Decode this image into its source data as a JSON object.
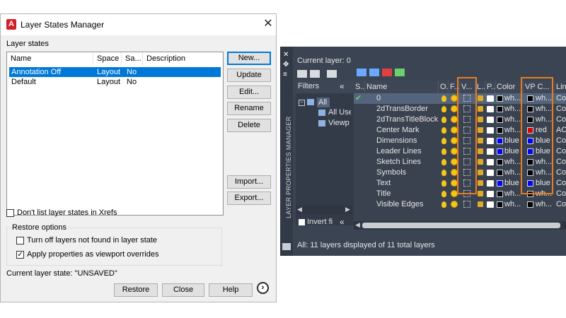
{
  "dialog": {
    "title": "Layer States Manager",
    "close_symbol": "✕",
    "layer_states_label": "Layer states",
    "columns": [
      "Name",
      "Space",
      "Sa...",
      "Description"
    ],
    "rows": [
      {
        "name": "Annotation Off",
        "space": "Layout",
        "saved": "No",
        "description": ""
      },
      {
        "name": "Default",
        "space": "Layout",
        "saved": "No",
        "description": ""
      }
    ],
    "buttons": {
      "new": "New...",
      "update": "Update",
      "edit": "Edit...",
      "rename": "Rename",
      "delete": "Delete",
      "import": "Import...",
      "export": "Export..."
    },
    "dont_list_xrefs": "Don't list layer states in Xrefs",
    "restore_options_label": "Restore options",
    "turn_off_layers": "Turn off layers not found in layer state",
    "apply_overrides": "Apply properties as viewport overrides",
    "current_state": "Current layer state: \"UNSAVED\"",
    "bottom": {
      "restore": "Restore",
      "close": "Close",
      "help": "Help",
      "more_symbol": "›"
    },
    "checkbox_states": {
      "dont_list_xrefs": false,
      "turn_off_layers": false,
      "apply_overrides": true
    }
  },
  "palette": {
    "current_layer": "Current layer: 0",
    "side_title": "LAYER PROPERTIES MANAGER",
    "filters_label": "Filters",
    "collapse_symbol": "«",
    "tree": [
      {
        "label": "All"
      },
      {
        "label": "All Use"
      },
      {
        "label": "Viewp"
      }
    ],
    "invert_filter": "Invert fi",
    "columns": [
      "S...",
      "Name",
      "O...",
      "F...",
      "V...",
      "L...",
      "P...",
      "Color",
      "VP C...",
      "Line"
    ],
    "layers": [
      {
        "status": "✔",
        "name": "0",
        "color_name": "wh...",
        "color": "#000000",
        "vp_color_name": "wh...",
        "vp_color": "#000000",
        "line": "Con"
      },
      {
        "status": "",
        "name": "2dTransBorder",
        "color_name": "wh...",
        "color": "#000000",
        "vp_color_name": "wh...",
        "vp_color": "#000000",
        "line": "Con"
      },
      {
        "status": "",
        "name": "2dTransTitleBlock",
        "color_name": "wh...",
        "color": "#000000",
        "vp_color_name": "wh...",
        "vp_color": "#000000",
        "line": "Con"
      },
      {
        "status": "",
        "name": "Center Mark",
        "color_name": "wh...",
        "color": "#000000",
        "vp_color_name": "red",
        "vp_color": "#e00000",
        "line": "ACA"
      },
      {
        "status": "",
        "name": "Dimensions",
        "color_name": "blue",
        "color": "#0000ff",
        "vp_color_name": "blue",
        "vp_color": "#0000ff",
        "line": "Con"
      },
      {
        "status": "",
        "name": "Leader Lines",
        "color_name": "blue",
        "color": "#0000ff",
        "vp_color_name": "blue",
        "vp_color": "#0000ff",
        "line": "Con"
      },
      {
        "status": "",
        "name": "Sketch Lines",
        "color_name": "wh...",
        "color": "#000000",
        "vp_color_name": "wh...",
        "vp_color": "#000000",
        "line": "Con"
      },
      {
        "status": "",
        "name": "Symbols",
        "color_name": "wh...",
        "color": "#000000",
        "vp_color_name": "wh...",
        "vp_color": "#000000",
        "line": "Con"
      },
      {
        "status": "",
        "name": "Text",
        "color_name": "blue",
        "color": "#0000ff",
        "vp_color_name": "blue",
        "vp_color": "#0000ff",
        "line": "Con"
      },
      {
        "status": "",
        "name": "Title",
        "color_name": "wh...",
        "color": "#000000",
        "vp_color_name": "wh...",
        "vp_color": "#000000",
        "line": "Con"
      },
      {
        "status": "",
        "name": "Visible Edges",
        "color_name": "wh...",
        "color": "#000000",
        "vp_color_name": "wh...",
        "vp_color": "#000000",
        "line": "Con"
      }
    ],
    "status": "All: 11 layers displayed of 11 total layers",
    "highlight_color": "#e87d1e"
  }
}
